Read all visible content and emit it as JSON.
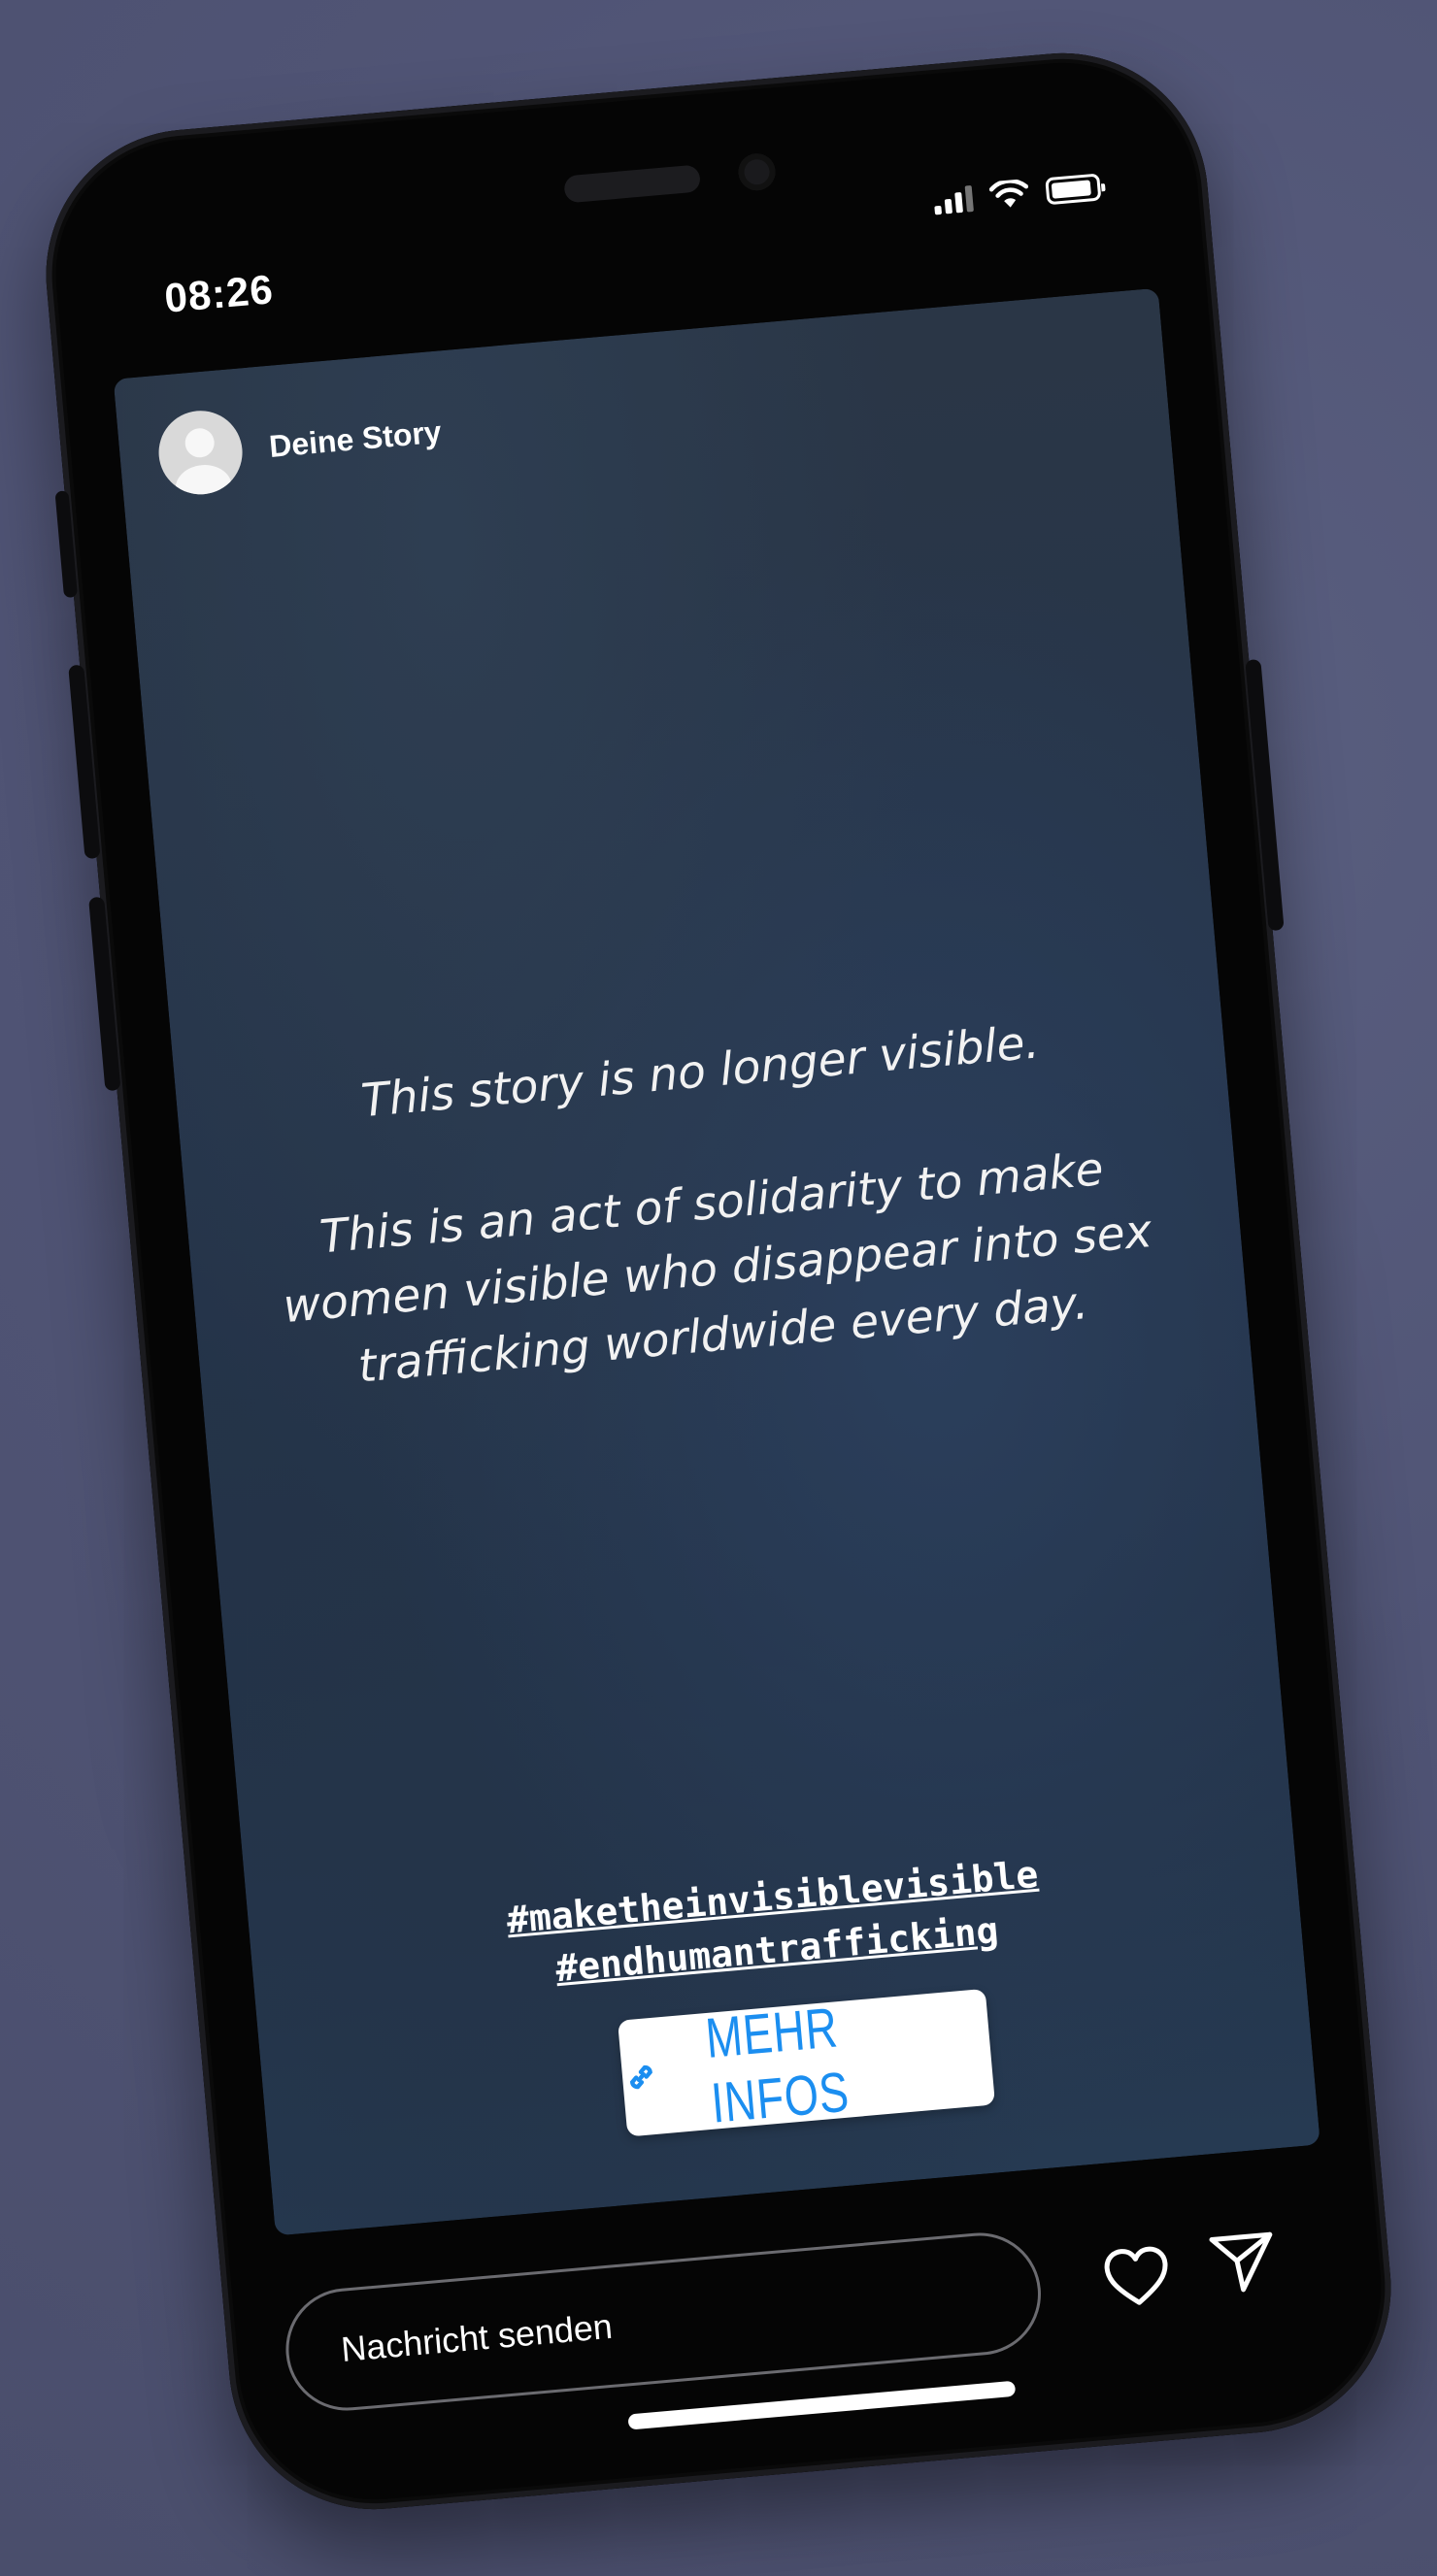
{
  "status_bar": {
    "time": "08:26",
    "icons": [
      "cellular-signal-icon",
      "wifi-icon",
      "battery-icon"
    ]
  },
  "story": {
    "username": "Deine Story",
    "avatar_icon": "default-avatar-icon",
    "headline": "This story is no longer visible.",
    "body_lines": [
      "This is an act of solidarity to make",
      "women visible who disappear into sex",
      "trafficking worldwide every day."
    ],
    "hashtags": [
      "#maketheinvisiblevisible",
      "#endhumantrafficking"
    ],
    "link_sticker": {
      "label": "MEHR INFOS",
      "icon": "link-icon"
    }
  },
  "footer": {
    "message_placeholder": "Nachricht senden",
    "like_icon": "heart-icon",
    "share_icon": "send-icon"
  },
  "colors": {
    "background": "#535777",
    "phone_body": "#050505",
    "story_bg": "#26354b",
    "link_text": "#1b8ef0",
    "text": "#ffffff"
  }
}
